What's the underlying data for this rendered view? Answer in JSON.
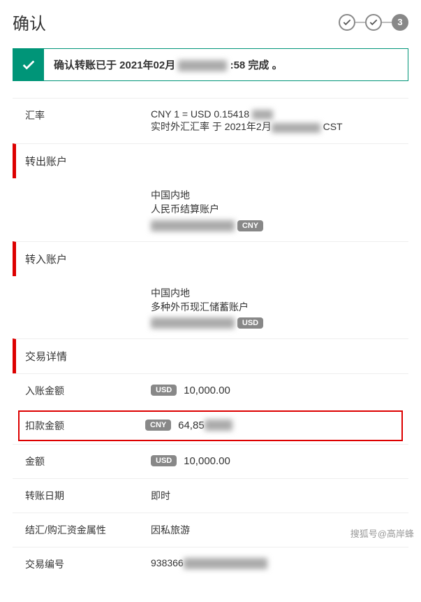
{
  "header": {
    "title": "确认",
    "step_current": "3"
  },
  "confirm": {
    "prefix": "确认转账已于 2021年02月",
    "redacted": "████",
    "suffix": ":58 完成 。"
  },
  "rate": {
    "label": "汇率",
    "line1": "CNY 1 = USD 0.15418",
    "line2_prefix": "实时外汇汇率 于 2021年2月",
    "line2_suffix": " CST"
  },
  "from": {
    "section": "转出账户",
    "region": "中国内地",
    "account": "人民币结算账户",
    "badge": "CNY"
  },
  "to": {
    "section": "转入账户",
    "region": "中国内地",
    "account": "多种外币现汇储蓄账户",
    "badge": "USD"
  },
  "details": {
    "section": "交易详情",
    "credit": {
      "label": "入账金额",
      "badge": "USD",
      "amount": "10,000.00"
    },
    "debit": {
      "label": "扣款金额",
      "badge": "CNY",
      "amount_prefix": "64,85"
    },
    "amount": {
      "label": "金额",
      "badge": "USD",
      "amount": "10,000.00"
    },
    "date": {
      "label": "转账日期",
      "value": "即时"
    },
    "purpose": {
      "label": "结汇/购汇资金属性",
      "value": "因私旅游"
    },
    "ref": {
      "label": "交易编号",
      "value_prefix": "938366"
    }
  },
  "watermark": "搜狐号@高岸蜂"
}
